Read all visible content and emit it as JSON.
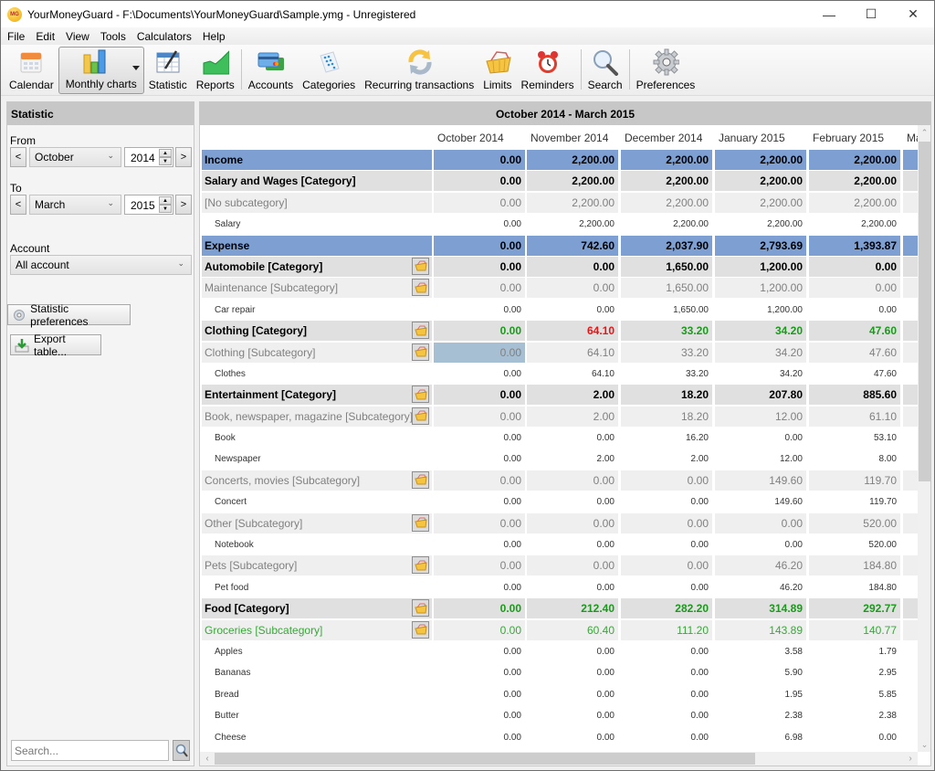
{
  "window": {
    "title": "YourMoneyGuard - F:\\Documents\\YourMoneyGuard\\Sample.ymg - Unregistered",
    "icon_label": "MG",
    "minimize": "—",
    "maximize": "☐",
    "close": "✕"
  },
  "menu": [
    "File",
    "Edit",
    "View",
    "Tools",
    "Calculators",
    "Help"
  ],
  "toolbar": {
    "buttons": [
      {
        "label": "Calendar",
        "icon": "calendar-icon"
      },
      {
        "label": "Monthly charts",
        "icon": "bar-chart-icon",
        "active": true,
        "dropdown": true
      },
      {
        "label": "Statistic",
        "icon": "statistic-table-icon"
      },
      {
        "label": "Reports",
        "icon": "area-chart-icon"
      },
      {
        "label": "Accounts",
        "icon": "credit-cards-icon"
      },
      {
        "label": "Categories",
        "icon": "categories-icon"
      },
      {
        "label": "Recurring transactions",
        "icon": "refresh-arrows-icon"
      },
      {
        "label": "Limits",
        "icon": "basket-icon"
      },
      {
        "label": "Reminders",
        "icon": "alarm-clock-icon"
      },
      {
        "label": "Search",
        "icon": "magnifier-icon"
      },
      {
        "label": "Preferences",
        "icon": "gear-icon"
      }
    ]
  },
  "left_panel": {
    "title": "Statistic",
    "from_label": "From",
    "from_month": "October",
    "from_year": "2014",
    "to_label": "To",
    "to_month": "March",
    "to_year": "2015",
    "prev": "<",
    "next": ">",
    "account_label": "Account",
    "account_value": "All account",
    "preferences_button": "Statistic preferences",
    "export_button": "Export table...",
    "search_placeholder": "Search..."
  },
  "main": {
    "title": "October 2014 - March 2015",
    "columns": [
      "October 2014",
      "November 2014",
      "December 2014",
      "January 2015",
      "February 2015",
      "Ma"
    ],
    "rows": [
      {
        "type": "group",
        "name": "Income",
        "values": [
          "0.00",
          "2,200.00",
          "2,200.00",
          "2,200.00",
          "2,200.00"
        ]
      },
      {
        "type": "cat",
        "name": "Salary and Wages [Category]",
        "values": [
          "0.00",
          "2,200.00",
          "2,200.00",
          "2,200.00",
          "2,200.00"
        ]
      },
      {
        "type": "sub",
        "name": "[No subcategory]",
        "values": [
          "0.00",
          "2,200.00",
          "2,200.00",
          "2,200.00",
          "2,200.00"
        ]
      },
      {
        "type": "item",
        "name": "Salary",
        "values": [
          "0.00",
          "2,200.00",
          "2,200.00",
          "2,200.00",
          "2,200.00"
        ]
      },
      {
        "type": "group",
        "name": "Expense",
        "values": [
          "0.00",
          "742.60",
          "2,037.90",
          "2,793.69",
          "1,393.87"
        ]
      },
      {
        "type": "cat",
        "name": "Automobile [Category]",
        "tag": true,
        "values": [
          "0.00",
          "0.00",
          "1,650.00",
          "1,200.00",
          "0.00"
        ]
      },
      {
        "type": "sub",
        "name": "Maintenance [Subcategory]",
        "tag": true,
        "values": [
          "0.00",
          "0.00",
          "1,650.00",
          "1,200.00",
          "0.00"
        ]
      },
      {
        "type": "item",
        "name": "Car repair",
        "values": [
          "0.00",
          "0.00",
          "1,650.00",
          "1,200.00",
          "0.00"
        ]
      },
      {
        "type": "cat",
        "name": "Clothing [Category]",
        "tag": true,
        "values": [
          "0.00",
          "64.10",
          "33.20",
          "34.20",
          "47.60"
        ],
        "colors": [
          "green",
          "red",
          "green",
          "green",
          "green"
        ]
      },
      {
        "type": "sub",
        "name": "Clothing [Subcategory]",
        "tag": true,
        "values": [
          "0.00",
          "64.10",
          "33.20",
          "34.20",
          "47.60"
        ],
        "selected": 0
      },
      {
        "type": "item",
        "name": "Clothes",
        "values": [
          "0.00",
          "64.10",
          "33.20",
          "34.20",
          "47.60"
        ]
      },
      {
        "type": "cat",
        "name": "Entertainment [Category]",
        "tag": true,
        "values": [
          "0.00",
          "2.00",
          "18.20",
          "207.80",
          "885.60"
        ]
      },
      {
        "type": "sub",
        "name": "Book, newspaper, magazine [Subcategory]",
        "tag": true,
        "values": [
          "0.00",
          "2.00",
          "18.20",
          "12.00",
          "61.10"
        ]
      },
      {
        "type": "item",
        "name": "Book",
        "values": [
          "0.00",
          "0.00",
          "16.20",
          "0.00",
          "53.10"
        ]
      },
      {
        "type": "item",
        "name": "Newspaper",
        "values": [
          "0.00",
          "2.00",
          "2.00",
          "12.00",
          "8.00"
        ]
      },
      {
        "type": "sub",
        "name": "Concerts, movies [Subcategory]",
        "tag": true,
        "values": [
          "0.00",
          "0.00",
          "0.00",
          "149.60",
          "119.70"
        ]
      },
      {
        "type": "item",
        "name": "Concert",
        "values": [
          "0.00",
          "0.00",
          "0.00",
          "149.60",
          "119.70"
        ]
      },
      {
        "type": "sub",
        "name": "Other [Subcategory]",
        "tag": true,
        "values": [
          "0.00",
          "0.00",
          "0.00",
          "0.00",
          "520.00"
        ]
      },
      {
        "type": "item",
        "name": "Notebook",
        "values": [
          "0.00",
          "0.00",
          "0.00",
          "0.00",
          "520.00"
        ]
      },
      {
        "type": "sub",
        "name": "Pets [Subcategory]",
        "tag": true,
        "values": [
          "0.00",
          "0.00",
          "0.00",
          "46.20",
          "184.80"
        ]
      },
      {
        "type": "item",
        "name": "Pet food",
        "values": [
          "0.00",
          "0.00",
          "0.00",
          "46.20",
          "184.80"
        ]
      },
      {
        "type": "cat",
        "name": "Food [Category]",
        "tag": true,
        "values": [
          "0.00",
          "212.40",
          "282.20",
          "314.89",
          "292.77"
        ],
        "colors": [
          "green",
          "green",
          "green",
          "green",
          "green"
        ]
      },
      {
        "type": "sub",
        "name": "Groceries [Subcategory]",
        "tag": true,
        "values": [
          "0.00",
          "60.40",
          "111.20",
          "143.89",
          "140.77"
        ],
        "colors": [
          "green",
          "green",
          "green",
          "green",
          "green"
        ]
      },
      {
        "type": "item",
        "name": "Apples",
        "values": [
          "0.00",
          "0.00",
          "0.00",
          "3.58",
          "1.79"
        ]
      },
      {
        "type": "item",
        "name": "Bananas",
        "values": [
          "0.00",
          "0.00",
          "0.00",
          "5.90",
          "2.95"
        ]
      },
      {
        "type": "item",
        "name": "Bread",
        "values": [
          "0.00",
          "0.00",
          "0.00",
          "1.95",
          "5.85"
        ]
      },
      {
        "type": "item",
        "name": "Butter",
        "values": [
          "0.00",
          "0.00",
          "0.00",
          "2.38",
          "2.38"
        ]
      },
      {
        "type": "item",
        "name": "Cheese",
        "values": [
          "0.00",
          "0.00",
          "0.00",
          "6.98",
          "0.00"
        ]
      }
    ]
  },
  "colors": {
    "group_row": "#7d9fd2",
    "positive": "#1a9a1a",
    "negative": "#e81515",
    "selected_cell": "#a7bfd3"
  }
}
